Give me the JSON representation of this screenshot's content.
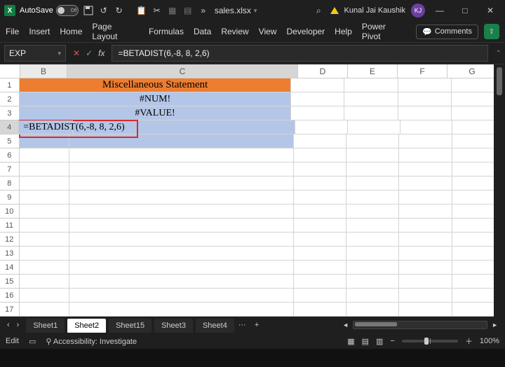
{
  "title": {
    "autosave_label": "AutoSave",
    "autosave_state": "Off",
    "filename": "sales.xlsx",
    "user_name": "Kunal Jai Kaushik",
    "user_initials": "KJ"
  },
  "ribbon": {
    "tabs": [
      "File",
      "Insert",
      "Home",
      "Page Layout",
      "Formulas",
      "Data",
      "Review",
      "View",
      "Developer",
      "Help",
      "Power Pivot"
    ],
    "comments": "Comments"
  },
  "formula": {
    "namebox": "EXP",
    "formula_text": "=BETADIST(6,-8, 8, 2,6)"
  },
  "columns": [
    "B",
    "C",
    "D",
    "E",
    "F",
    "G"
  ],
  "row_numbers": [
    "1",
    "2",
    "3",
    "4",
    "5",
    "6",
    "7",
    "8",
    "9",
    "10",
    "11",
    "12",
    "13",
    "14",
    "15",
    "16",
    "17"
  ],
  "cells": {
    "title_merged": "Miscellaneous Statement",
    "r2": "#NUM!",
    "r3": "#VALUE!",
    "r4_editing": "=BETADIST(6,-8, 8, 2,6)"
  },
  "sheets": {
    "tabs": [
      "Sheet1",
      "Sheet2",
      "Sheet15",
      "Sheet3",
      "Sheet4"
    ],
    "active_index": 1,
    "more": "···",
    "add": "+"
  },
  "status": {
    "mode": "Edit",
    "accessibility": "Accessibility: Investigate",
    "zoom": "100%"
  },
  "icons": {
    "minimize": "—",
    "maximize": "□",
    "close": "✕",
    "dropdown": "▾",
    "cancel": "✕",
    "enter": "✓",
    "chevL": "‹",
    "chevR": "›",
    "tri_l": "◄",
    "tri_r": "►",
    "plus": "＋",
    "minus": "−",
    "overflow": "»",
    "search": "⌕"
  }
}
